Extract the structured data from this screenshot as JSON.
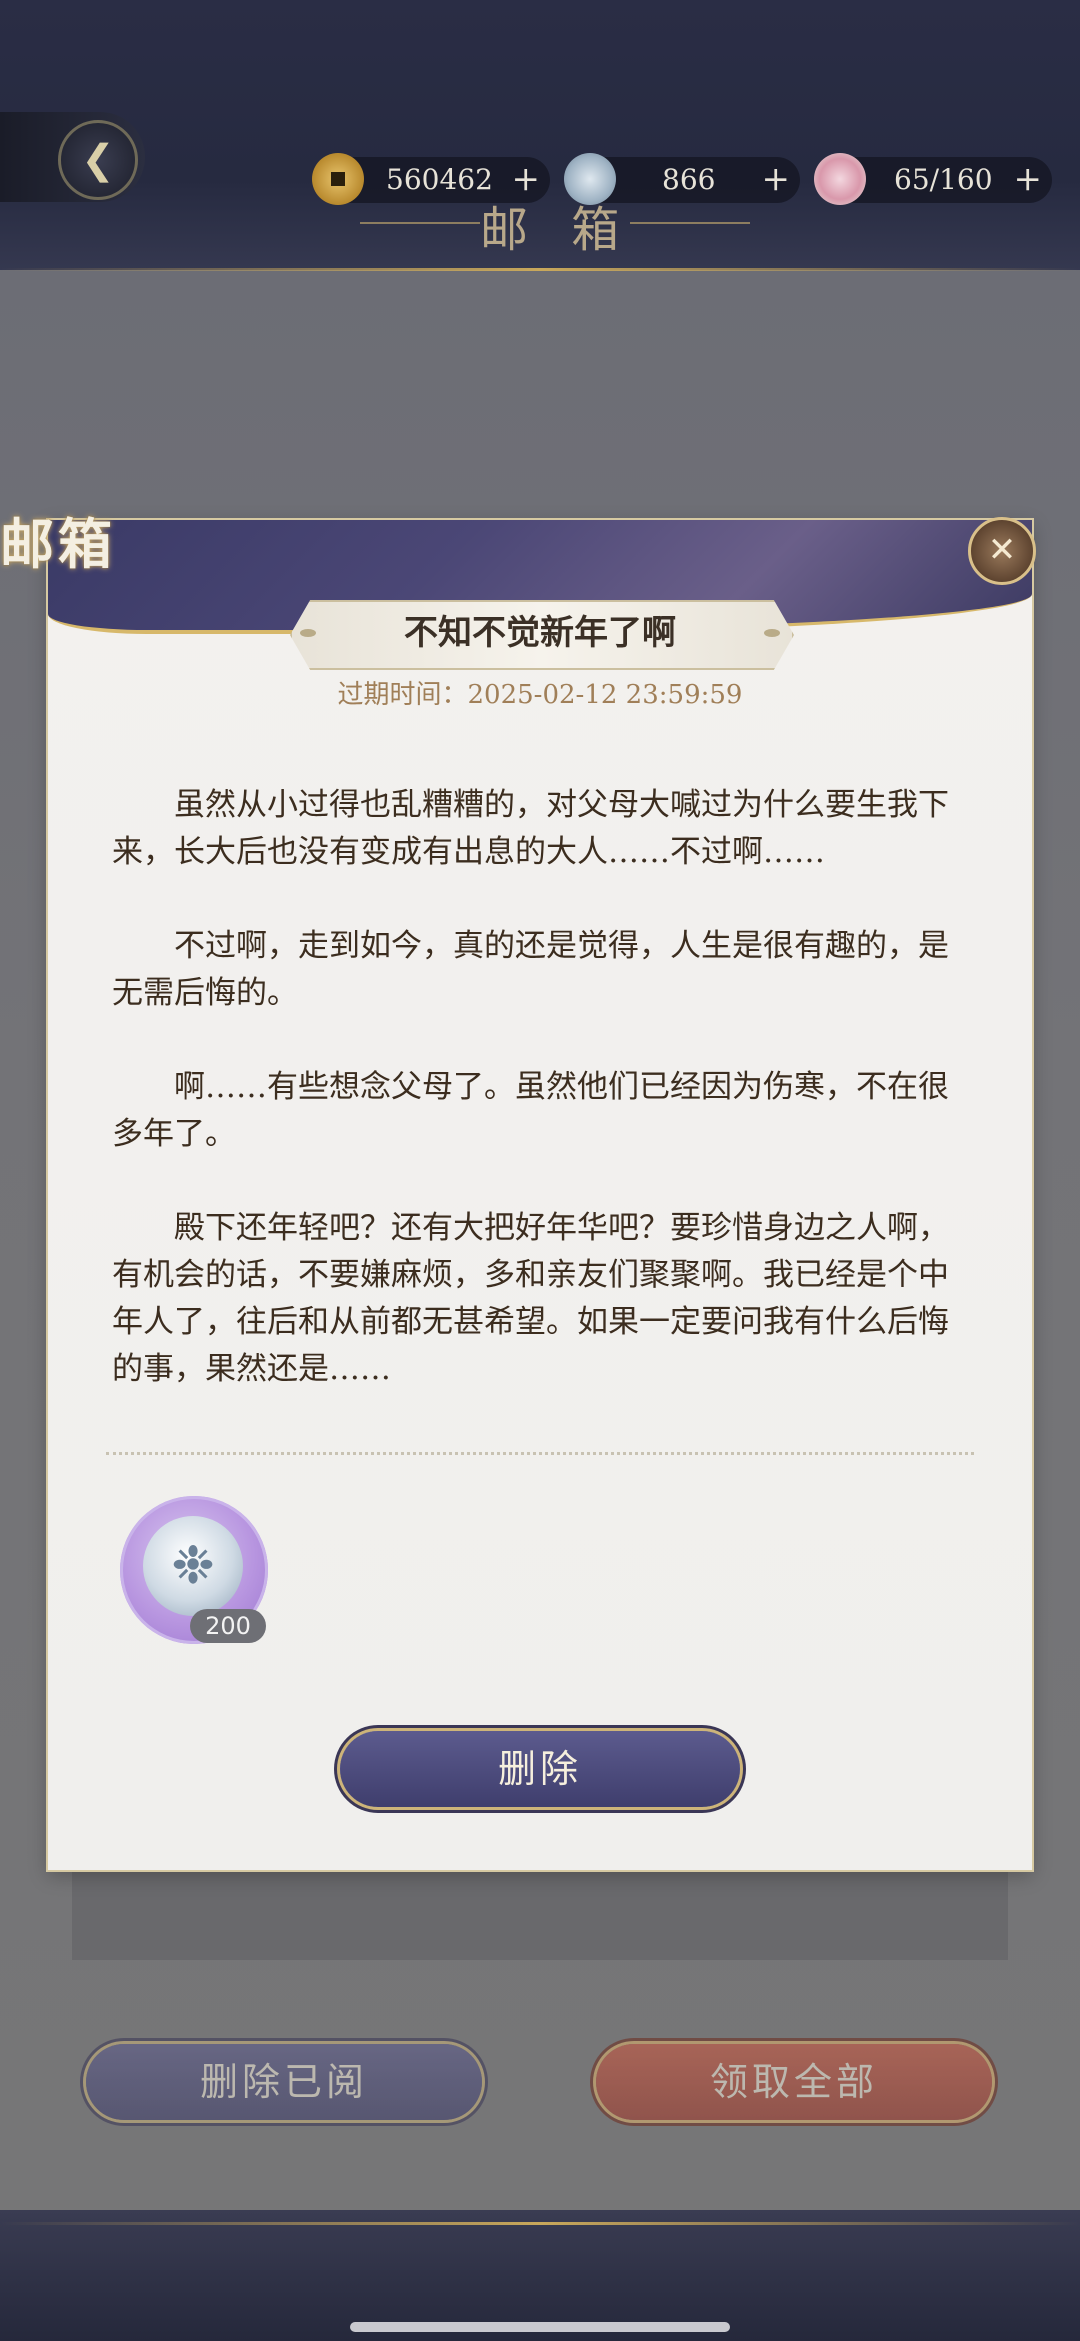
{
  "resources": [
    {
      "icon": "copper-coin-icon",
      "value": "560462"
    },
    {
      "icon": "jade-icon",
      "value": "866"
    },
    {
      "icon": "food-bowl-icon",
      "value": "65/160"
    }
  ],
  "resource_plus": "+",
  "page_title": "邮 箱",
  "modal": {
    "tag": "邮箱",
    "close_symbol": "✕",
    "mail_title": "不知不觉新年了啊",
    "expiry": "过期时间：2025-02-12 23:59:59",
    "paragraphs": [
      "虽然从小过得也乱糟糟的，对父母大喊过为什么要生我下来，长大后也没有变成有出息的大人……不过啊……",
      "不过啊，走到如今，真的还是觉得，人生是很有趣的，是无需后悔的。",
      "啊……有些想念父母了。虽然他们已经因为伤寒，不在很多年了。",
      "殿下还年轻吧？还有大把好年华吧？要珍惜身边之人啊，有机会的话，不要嫌麻烦，多和亲友们聚聚啊。我已经是个中年人了，往后和从前都无甚希望。如果一定要问我有什么后悔的事，果然还是……"
    ],
    "reward": {
      "icon": "jade-icon",
      "count": "200"
    },
    "delete_button": "删除"
  },
  "bottom_buttons": {
    "delete_read": "删除已阅",
    "claim_all": "领取全部"
  },
  "colors": {
    "accent_gold": "#c9a85b",
    "button_purple": "#4a497a",
    "button_red": "#b9452f"
  }
}
